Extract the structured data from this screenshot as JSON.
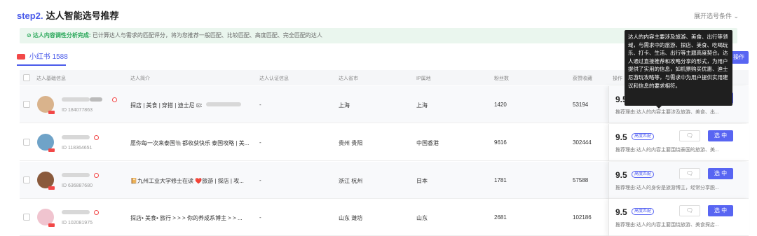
{
  "header": {
    "step": "step2.",
    "title": "达人智能选号推荐",
    "expand": "展开选号条件 ⌄"
  },
  "notice": {
    "title": "⊘ 达人内容调性分析完成:",
    "text": "已计算达人与需求的匹配评分，将为您推荐一般匹配、比较匹配、高度匹配、完全匹配的达人"
  },
  "platform_tab": {
    "label": "小红书",
    "count": "1588"
  },
  "batch_button": "操作",
  "columns": [
    "达人基础信息",
    "达人简介",
    "达人认证信息",
    "达人省市",
    "IP属地",
    "粉丝数",
    "获赞收藏",
    "操作"
  ],
  "rows": [
    {
      "id": "ID 184077863",
      "intro": "探店 | 美食 | 穿搭 | 迪士尼 ⊡:",
      "cert": "-",
      "city": "上海",
      "ip": "上海",
      "fans": "1420",
      "likes": "53194",
      "score": "9.5",
      "tag": "",
      "like_icon": "",
      "select_label": "选 中",
      "reason": "推荐理由:达人的内容主要涉及旅游、美食、出..."
    },
    {
      "id": "ID 118364651",
      "intro": "愿你每一次来泰国🐘都收获快乐 泰国攻略 | 美...",
      "cert": "-",
      "city": "贵州 贵阳",
      "ip": "中国香港",
      "fans": "9616",
      "likes": "302444",
      "score": "9.5",
      "tag": "高度匹配",
      "like_icon": "🗨",
      "select_label": "选 中",
      "reason": "推荐理由:达人的内容主要围绕泰国的旅游、美..."
    },
    {
      "id": "ID 636887680",
      "intro": "📔九州工业大学修士在读 ❤️旅游 | 探店 | 攻...",
      "cert": "-",
      "city": "浙江 杭州",
      "ip": "日本",
      "fans": "1781",
      "likes": "57588",
      "score": "9.5",
      "tag": "高度匹配",
      "like_icon": "🗨",
      "select_label": "选 中",
      "reason": "推荐理由:达人的身份是旅游博主，经常分享脱..."
    },
    {
      "id": "ID 102081975",
      "intro": "探店• 美食• 旅行 > > > 你的养成系博主 > > ...",
      "cert": "-",
      "city": "山东 潍坊",
      "ip": "山东",
      "fans": "2681",
      "likes": "102186",
      "score": "9.5",
      "tag": "高度匹配",
      "like_icon": "🗨",
      "select_label": "选 中",
      "reason": "推荐理由:达人的内容主要围绕旅游、美食探店..."
    }
  ],
  "tooltip": "达人的内容主要涉及旅游、美食、出行等领域，与需求中的旅游、探店、美食、吃喝玩乐、打卡、生活、出行等主题高度契合。达人通过直接推荐和攻略分享的形式，为用户提供了实用的信息，如机票购买优惠、迪士尼游玩攻略等，与需求中为用户提供实用建议和信息的要求相符。"
}
